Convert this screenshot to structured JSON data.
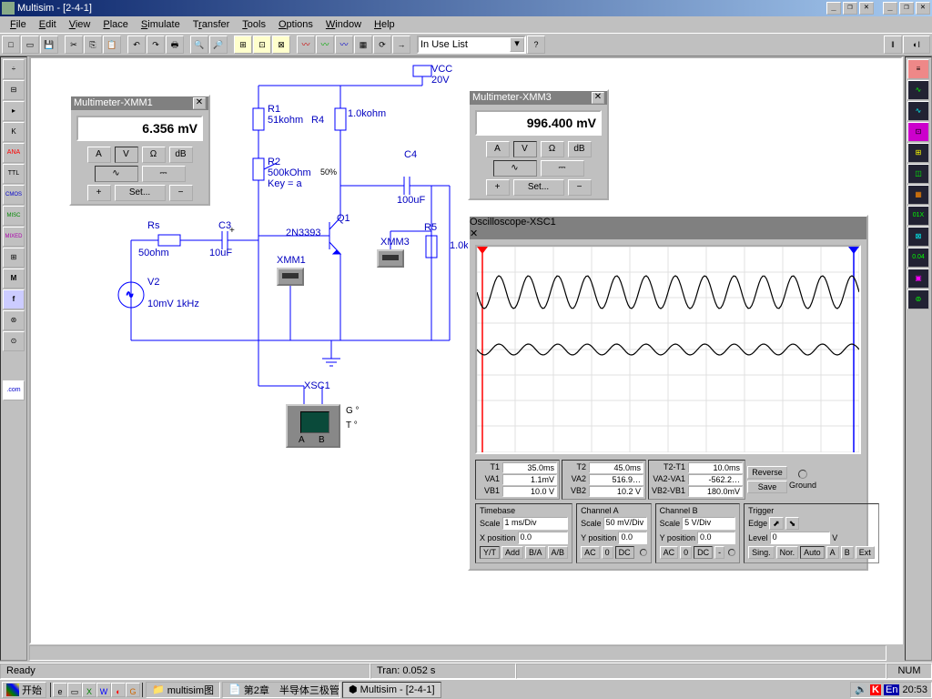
{
  "title": "Multisim - [2-4-1]",
  "menu": [
    "File",
    "Edit",
    "View",
    "Place",
    "Simulate",
    "Transfer",
    "Tools",
    "Options",
    "Window",
    "Help"
  ],
  "combo": "In Use List",
  "status_left": "Ready",
  "status_mid": "Tran: 0.052 s",
  "status_right": "NUM",
  "taskbar": {
    "start": "开始",
    "items": [
      "multisim图",
      "第2章　半导体三极管…",
      "Multisim - [2-4-1]"
    ],
    "clock": "20:53",
    "lang": "En"
  },
  "xmm1": {
    "title": "Multimeter-XMM1",
    "value": "6.356 mV",
    "set": "Set..."
  },
  "xmm3": {
    "title": "Multimeter-XMM3",
    "value": "996.400 mV",
    "set": "Set..."
  },
  "scope": {
    "title": "Oscilloscope-XSC1",
    "readout": {
      "T1": "35.0ms",
      "VA1": "1.1mV",
      "VB1": "10.0 V",
      "T2": "45.0ms",
      "VA2": "516.9…",
      "VB2": "10.2 V",
      "T2T1": "10.0ms",
      "VA2VA1": "-562.2…",
      "VB2VB1": "180.0mV"
    },
    "reverse": "Reverse",
    "save": "Save",
    "ground": "Ground",
    "timebase": {
      "label": "Timebase",
      "scale_lbl": "Scale",
      "scale": "1 ms/Div",
      "xpos_lbl": "X position",
      "xpos": "0.0",
      "btns": [
        "Y/T",
        "Add",
        "B/A",
        "A/B"
      ]
    },
    "chA": {
      "label": "Channel A",
      "scale_lbl": "Scale",
      "scale": "50 mV/Div",
      "ypos_lbl": "Y position",
      "ypos": "0.0",
      "btns": [
        "AC",
        "0",
        "DC"
      ]
    },
    "chB": {
      "label": "Channel B",
      "scale_lbl": "Scale",
      "scale": "5 V/Div",
      "ypos_lbl": "Y position",
      "ypos": "0.0",
      "btns": [
        "AC",
        "0",
        "DC",
        "-"
      ]
    },
    "trig": {
      "label": "Trigger",
      "edge_lbl": "Edge",
      "level_lbl": "Level",
      "level": "0",
      "unit": "V",
      "btns": [
        "Sing.",
        "Nor.",
        "Auto",
        "A",
        "B",
        "Ext"
      ]
    }
  },
  "circuit": {
    "VCC": "VCC",
    "V20": "20V",
    "R1": "R1",
    "R1v": "51kohm",
    "R4": "R4",
    "R4v": "1.0kohm",
    "R2": "R2",
    "R2v": "500kOhm",
    "R2k": "Key = a",
    "pct": "50%",
    "C4": "C4",
    "C4v": "100uF",
    "Rs": "Rs",
    "Rsv": "50ohm",
    "C3": "C3",
    "C3v": "10uF",
    "Q1": "Q1",
    "Q1v": "2N3393",
    "XMM1": "XMM1",
    "XMM3": "XMM3",
    "R5": "R5",
    "R5v": "1.0k",
    "V2": "V2",
    "V2v": "10mV 1kHz",
    "XSC1": "XSC1",
    "G": "G °",
    "T": "T °",
    "A": "A",
    "B": "B"
  },
  "multi_buttons": {
    "A": "A",
    "V": "V",
    "Ohm": "Ω",
    "dB": "dB",
    "wave": "∿",
    "dc": "⎓",
    "plus": "+",
    "minus": "−"
  },
  "side_left": [
    "÷",
    "⊕",
    "⊣⊢",
    "K",
    "ANA",
    "TTL",
    "CMOS",
    "MISC",
    "MIXED",
    "⊟",
    "M",
    "f",
    "⊛",
    "⊙",
    ".com"
  ],
  "side_right": [
    "≡",
    "∿",
    "≈",
    "⊡",
    "⊞",
    "◫",
    "▦",
    "01X",
    "⊠",
    "0.04",
    "▣",
    "⊚"
  ]
}
